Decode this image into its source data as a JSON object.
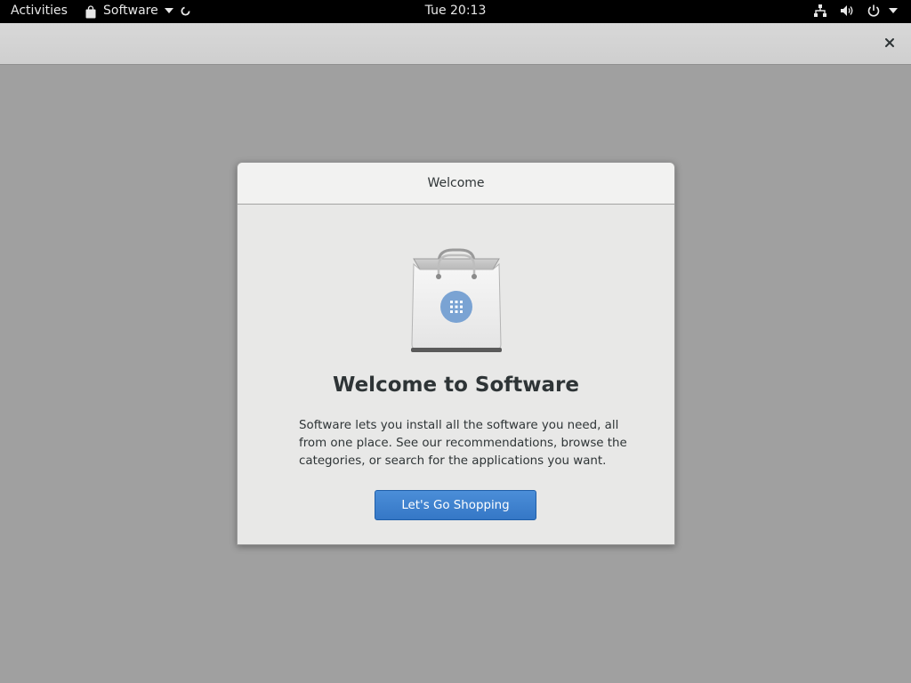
{
  "topbar": {
    "activities_label": "Activities",
    "app_name": "Software",
    "clock": "Tue 20:13"
  },
  "dialog": {
    "header_title": "Welcome",
    "title": "Welcome to Software",
    "description": "Software lets you install all the software you need, all from one place. See our recommendations, browse the categories, or search for the applications you want.",
    "button_label": "Let's Go Shopping"
  },
  "icons": {
    "app_menu": "shopping-bag-icon",
    "busy": "spinner-icon",
    "network": "network-icon",
    "volume": "volume-icon",
    "power": "power-icon",
    "window_close": "close-icon",
    "illustration": "software-bag-icon"
  },
  "colors": {
    "accent": "#3a7fcf",
    "topbar": "#000000",
    "desktop": "#a0a0a0"
  }
}
